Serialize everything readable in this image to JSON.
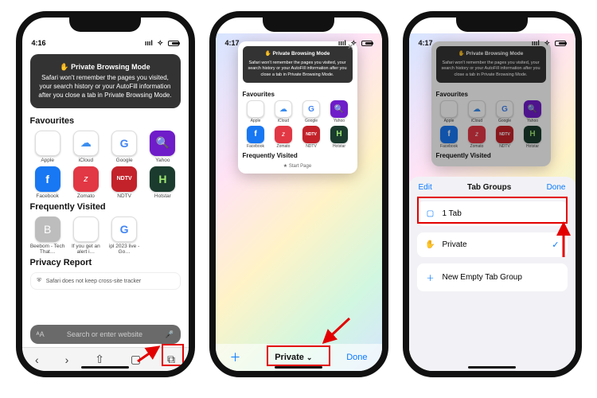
{
  "phone1": {
    "time": "4:16",
    "banner_title": "✋ Private Browsing Mode",
    "banner_body": "Safari won't remember the pages you visited, your search history or your AutoFill information after you close a tab in Private Browsing Mode.",
    "favourites_title": "Favourites",
    "favourites": [
      {
        "label": "Apple",
        "icon": ""
      },
      {
        "label": "iCloud",
        "icon": "☁"
      },
      {
        "label": "Google",
        "icon": "G"
      },
      {
        "label": "Yahoo",
        "icon": "🔍"
      },
      {
        "label": "Facebook",
        "icon": "f"
      },
      {
        "label": "Zomato",
        "icon": "z"
      },
      {
        "label": "NDTV",
        "icon": "NDTV"
      },
      {
        "label": "Hotstar",
        "icon": "H"
      }
    ],
    "frequently_title": "Frequently Visited",
    "frequently": [
      {
        "label": "Beebom - Tech That…",
        "icon": "B"
      },
      {
        "label": "If you get an alert i…",
        "icon": ""
      },
      {
        "label": "ipl 2023 live - Go…",
        "icon": "G"
      }
    ],
    "privacy_title": "Privacy Report",
    "privacy_line": "Safari does not keep cross-site tracker",
    "search_placeholder": "Search or enter website"
  },
  "phone2": {
    "time": "4:17",
    "banner_title": "✋ Private Browsing Mode",
    "banner_body": "Safari won't remember the pages you visited, your search history or your AutoFill information after you close a tab in Private Browsing Mode.",
    "favourites_title": "Favourites",
    "frequently_title": "Frequently Visited",
    "start_page": "Start Page",
    "bottom_center": "Private",
    "bottom_done": "Done"
  },
  "phone3": {
    "time": "4:17",
    "sheet_title": "Tab Groups",
    "edit": "Edit",
    "done": "Done",
    "row1": "1 Tab",
    "row2": "Private",
    "row3": "New Empty Tab Group"
  },
  "colors": {
    "apple_black": "#333333",
    "icloud_blue": "#3b8def",
    "google_y": "#f4b400",
    "yahoo_purple": "#6f1cc9",
    "facebook": "#1877f2",
    "zomato": "#e23744",
    "ndtv": "#c3222a",
    "hotstar": "#1a3b2e",
    "beebom": "#bdbdbd",
    "blue": "#0a7aff"
  }
}
